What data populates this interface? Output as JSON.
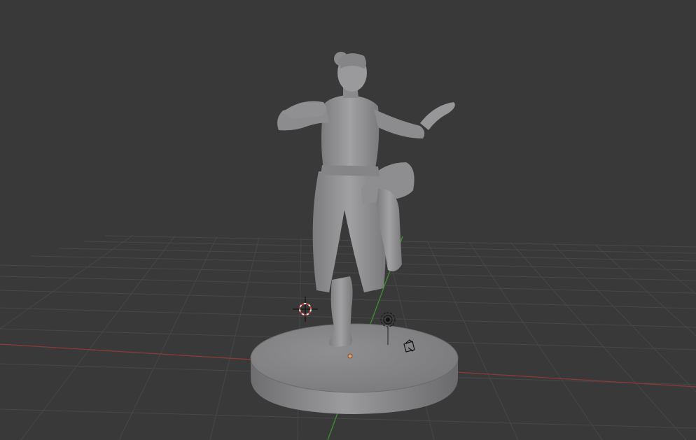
{
  "viewport": {
    "kind": "3d-viewport",
    "background_color": "#393939",
    "grid_color": "#474747",
    "x_axis_color": "#8b3a3a",
    "y_axis_color": "#3f8f2e"
  },
  "scene_objects": {
    "model": {
      "name": "figure-on-base-sculpt",
      "color": "#8a8a8c"
    },
    "cursor": {
      "name": "3d-cursor-icon"
    },
    "lamp": {
      "name": "lamp-icon"
    },
    "camera": {
      "name": "camera-icon"
    },
    "origin": {
      "name": "object-origin-dot",
      "color": "#e8a26a"
    }
  }
}
